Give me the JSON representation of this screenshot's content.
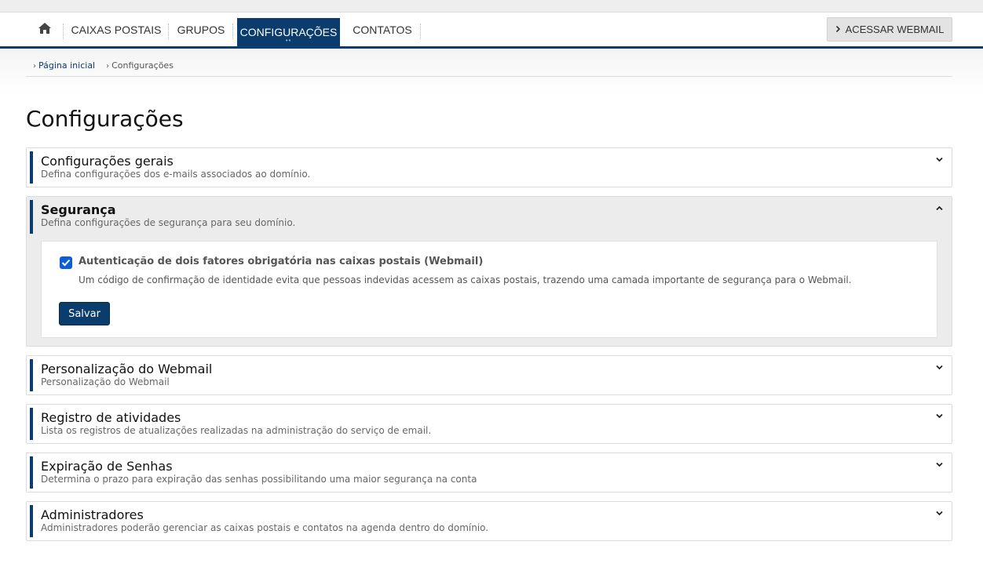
{
  "nav": {
    "home_icon": "home-icon",
    "items": [
      {
        "label": "CAIXAS POSTAIS"
      },
      {
        "label": "GRUPOS"
      },
      {
        "label": "CONFIGURAÇÕES",
        "active": true
      },
      {
        "label": "CONTATOS"
      }
    ],
    "webmail_label": "ACESSAR WEBMAIL"
  },
  "breadcrumb": {
    "home": "Página inicial",
    "current": "Configurações"
  },
  "page_title": "Configurações",
  "sections": [
    {
      "title": "Configurações gerais",
      "subtitle": "Defina configurações dos e-mails associados ao domínio.",
      "expanded": false
    },
    {
      "title": "Segurança",
      "subtitle": "Defina configurações de segurança para seu domínio.",
      "expanded": true,
      "option": {
        "checked": true,
        "label": "Autenticação de dois fatores obrigatória nas caixas postais (Webmail)",
        "help": "Um código de confirmação de identidade evita que pessoas indevidas acessem as caixas postais, trazendo uma camada importante de segurança para o Webmail."
      },
      "save_label": "Salvar"
    },
    {
      "title": "Personalização do Webmail",
      "subtitle": "Personalização do Webmail",
      "expanded": false
    },
    {
      "title": "Registro de atividades",
      "subtitle": "Lista os registros de atualizações realizadas na administração do serviço de email.",
      "expanded": false
    },
    {
      "title": "Expiração de Senhas",
      "subtitle": "Determina o prazo para expiração das senhas possibilitando uma maior segurança na conta",
      "expanded": false
    },
    {
      "title": "Administradores",
      "subtitle": "Administradores poderão gerenciar as caixas postais e contatos na agenda dentro do domínio.",
      "expanded": false
    }
  ],
  "colors": {
    "brand": "#0b3c6e",
    "checkbox": "#0b5ed7",
    "open_panel_bg": "#ececec"
  }
}
